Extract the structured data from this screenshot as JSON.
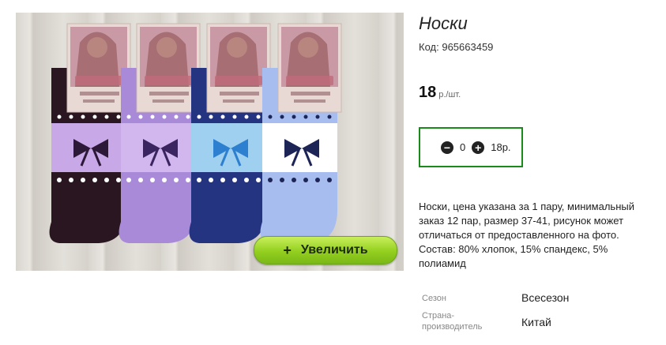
{
  "product": {
    "title": "Носки",
    "code_label": "Код:",
    "code_value": "965663459",
    "price_value": "18",
    "price_unit": "р./шт.",
    "quantity": "0",
    "sum": "18р.",
    "description": "Носки, цена указана за 1 пару, минимальный заказ 12 пар, размер 37-41, рисунок может отличаться от предоставленного на фото. Состав: 80% хлопок, 15% спандекс, 5% полиамид"
  },
  "photo": {
    "zoom_label": "Увеличить",
    "zoom_icon": "+",
    "sock_colors": [
      "#2a1620",
      "#a98ad9",
      "#253481",
      "#a7bdf0"
    ],
    "band_colors": [
      "#c8a8e6",
      "#d2b6ee",
      "#9fd0f0",
      "#ffffff"
    ],
    "bow_colors": [
      "#2c1938",
      "#3a2560",
      "#2d7fd0",
      "#1d2556"
    ]
  },
  "specs": [
    {
      "label": "Сезон",
      "value": "Всесезон"
    },
    {
      "label": "Страна-производитель",
      "value": "Китай"
    }
  ],
  "icons": {
    "minus": "minus-circle-icon",
    "plus": "plus-circle-icon"
  }
}
